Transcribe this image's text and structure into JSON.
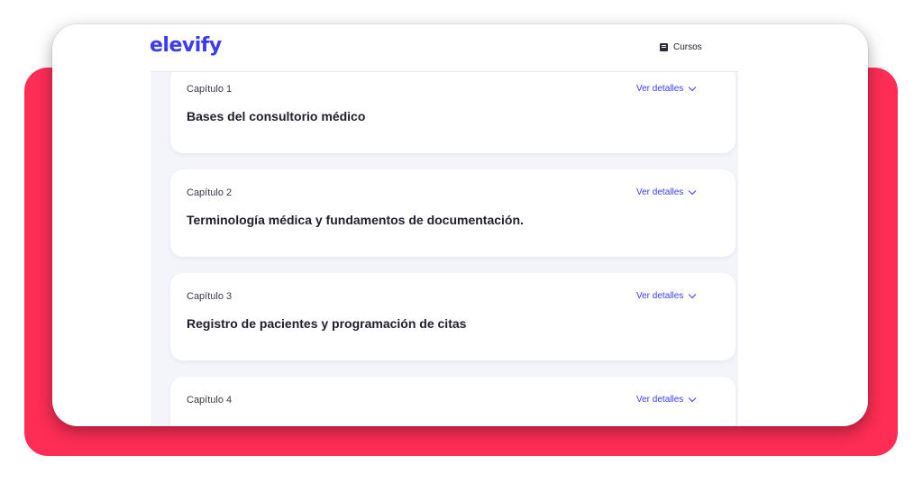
{
  "brand": {
    "logo_text": "elevify",
    "accent_color": "#3b3bf0",
    "backdrop_color": "#fe2d55"
  },
  "nav": {
    "courses_label": "Cursos",
    "courses_icon": "book-icon"
  },
  "chapters": [
    {
      "label": "Capítulo 1",
      "title": "Bases del consultorio médico",
      "details_label": "Ver detalles"
    },
    {
      "label": "Capítulo 2",
      "title": "Terminología médica y fundamentos de documentación.",
      "details_label": "Ver detalles"
    },
    {
      "label": "Capítulo 3",
      "title": "Registro de pacientes y programación de citas",
      "details_label": "Ver detalles"
    },
    {
      "label": "Capítulo 4",
      "title": "",
      "details_label": "Ver detalles"
    }
  ]
}
